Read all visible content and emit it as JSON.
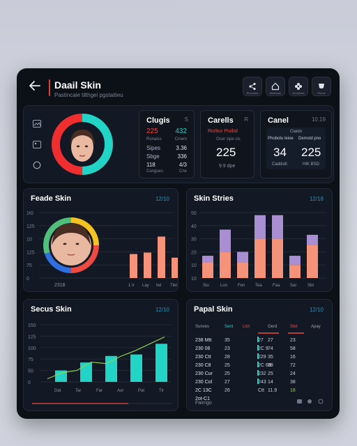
{
  "app": {
    "title": "Daail Skin",
    "subtitle": "Pastincaie tilthgei pgstaitieu"
  },
  "top_actions": [
    {
      "icon": "share-icon",
      "label": "Shecame"
    },
    {
      "icon": "home-icon",
      "label": "Meirbuan"
    },
    {
      "icon": "flower-icon",
      "label": "Dociestra"
    },
    {
      "icon": "cup-icon",
      "label": "Peuce"
    }
  ],
  "overview": {
    "side_icons": [
      "image-icon",
      "picture-icon",
      "circle-icon"
    ],
    "clugis": {
      "title": "Clugis",
      "tag": "S",
      "rows": [
        {
          "label": "225",
          "value": "432",
          "highlight": true
        },
        {
          "label": "Ronaiss",
          "value": "Cinem"
        },
        {
          "label": "Sipes",
          "value": "3.36"
        },
        {
          "label": "Sbge",
          "value": "336"
        },
        {
          "label": "118",
          "value": "4/3"
        },
        {
          "label": "Cangues",
          "value": "Cne"
        }
      ]
    },
    "carells": {
      "title": "Carells",
      "tag": "R",
      "caption": "Rorbur Piuibd",
      "sub": "Ocer sipe cis",
      "value": "225",
      "foot": "9.9 dpe"
    },
    "canel": {
      "title": "Canel",
      "tag": "10.19",
      "caption": "Claido",
      "left_label": "Phobotu leioe",
      "left_value": "34",
      "left_foot": "Caddstil",
      "right_label": "Demstd pno",
      "right_value": "225",
      "right_foot": "HIK BSD"
    }
  },
  "colors": {
    "accent_red": "#ef4a42",
    "accent_teal": "#22d4c5",
    "bar_salmon": "#f4937a",
    "bar_purple": "#a98fd1"
  },
  "chart_data": [
    {
      "type": "bar",
      "title": "Feade Skin",
      "tag": "12/10",
      "y_ticks": [
        "1t0",
        "125",
        "10",
        "125",
        "75",
        "0"
      ],
      "categories": [
        "1 Ir",
        "Lay",
        "Iwl",
        "Tlet",
        "Cel"
      ],
      "values": [
        33,
        35,
        57,
        28,
        17
      ],
      "x_left_label": "2318",
      "ylim": [
        0,
        90
      ]
    },
    {
      "type": "bar",
      "title": "Skin Stries",
      "tag": "12/18",
      "y_ticks": [
        "50",
        "40",
        "30",
        "20",
        "10",
        "10"
      ],
      "categories": [
        "Siu",
        "Lun",
        "Fen",
        "Tea",
        "Faa",
        "Sar",
        "Sbt"
      ],
      "series": [
        {
          "values": [
            12,
            20,
            12,
            30,
            30,
            10,
            25
          ]
        },
        {
          "values": [
            5,
            17,
            8,
            18,
            18,
            7,
            8
          ]
        }
      ],
      "ylim": [
        0,
        50
      ]
    },
    {
      "type": "bar",
      "title": "Secus Skin",
      "tag": "12/10",
      "y_ticks": [
        "150",
        "125",
        "100",
        "75",
        "50",
        "0"
      ],
      "categories": [
        "Dat",
        "Tar",
        "Far",
        "Aur",
        "Pat",
        "Tir"
      ],
      "values": [
        30,
        51,
        68,
        72,
        100
      ],
      "trend": [
        8,
        24,
        30,
        52,
        48,
        67,
        82,
        100,
        118
      ],
      "ylim": [
        0,
        150
      ]
    },
    {
      "type": "table",
      "title": "Papal Skin",
      "tag": "12/10",
      "columns": [
        "Sunves",
        "Sent",
        "Ltot",
        "Oerd",
        "Stet",
        "Apay"
      ],
      "rows": [
        [
          "238 Mtt",
          "35",
          "27",
          "27",
          "23"
        ],
        [
          "230 06",
          "23",
          "2C 9",
          "74",
          "58"
        ],
        [
          "230 Ctt",
          "28",
          "229",
          "35",
          "16"
        ],
        [
          "230 C8",
          "25",
          "2C 6B",
          "38",
          "72"
        ],
        [
          "230 Cur",
          "25",
          "232",
          "25",
          "24"
        ],
        [
          "230 Col",
          "27",
          "243",
          "14",
          "38"
        ],
        [
          "2C 13C",
          "26",
          "Ctt",
          "11.9",
          "18"
        ],
        [
          "2ot-C1",
          "",
          "",
          "",
          ""
        ]
      ],
      "foot": "Fairrigo"
    }
  ]
}
